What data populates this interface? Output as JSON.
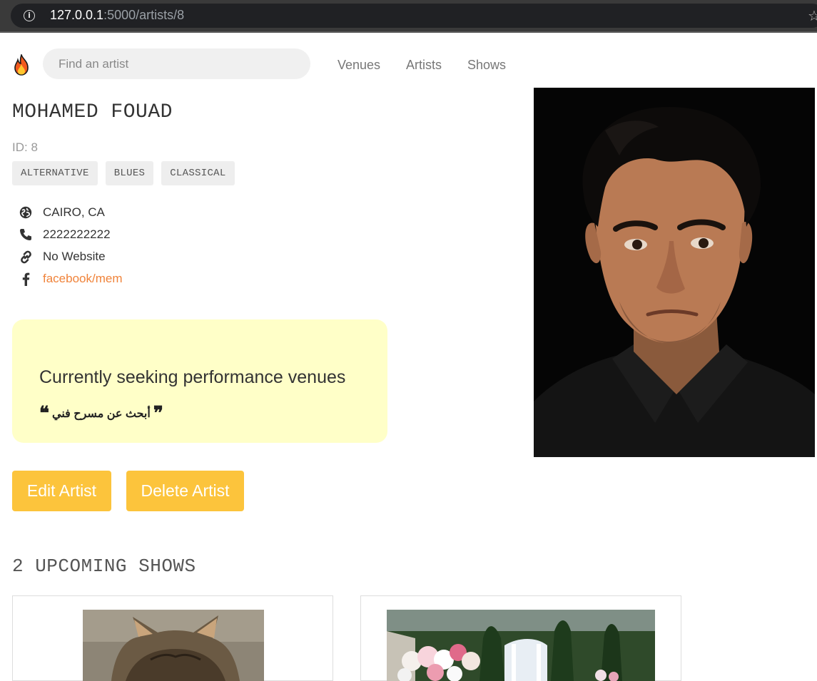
{
  "browser": {
    "url_host": "127.0.0.1",
    "url_rest": ":5000/artists/8",
    "info_icon": "i",
    "star_icon": "☆"
  },
  "nav": {
    "search_placeholder": "Find an artist",
    "links": [
      "Venues",
      "Artists",
      "Shows"
    ]
  },
  "artist": {
    "name": "MOHAMED FOUAD",
    "id_label": "ID: 8",
    "genres": [
      "ALTERNATIVE",
      "BLUES",
      "CLASSICAL"
    ],
    "city_state": "CAIRO, CA",
    "phone": "2222222222",
    "website": "No Website",
    "facebook": "facebook/mem"
  },
  "seeking": {
    "title": "Currently seeking performance venues",
    "description": "أبحث عن مسرح فني",
    "open_quote": "❝",
    "close_quote": "❞"
  },
  "buttons": {
    "edit": "Edit Artist",
    "delete": "Delete Artist"
  },
  "upcoming": {
    "heading": "2 UPCOMING SHOWS"
  },
  "colors": {
    "accent": "#fcc43c",
    "link": "#f0833a",
    "seeking_bg": "#ffffc8"
  }
}
